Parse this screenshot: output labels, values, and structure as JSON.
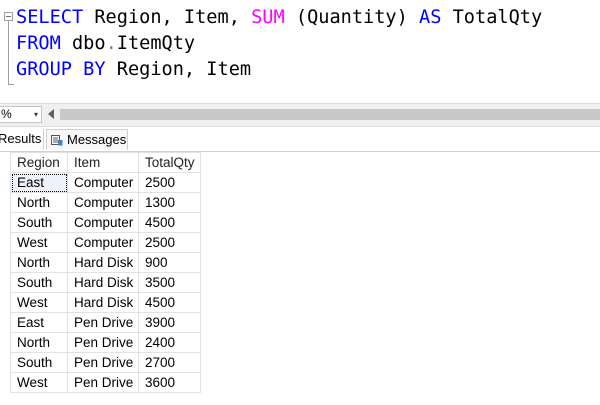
{
  "editor": {
    "line1": {
      "kw1": "SELECT",
      "t1": " Region, Item, ",
      "fn": "SUM",
      "t2": " (Quantity) ",
      "kw2": "AS",
      "t3": " TotalQty"
    },
    "line2": {
      "kw1": "FROM",
      "t1": " dbo",
      "op": ".",
      "t2": "ItemQty"
    },
    "line3": {
      "kw1": "GROUP BY",
      "t1": " Region, Item"
    }
  },
  "zoom": {
    "value": "%",
    "arrow": "▾"
  },
  "tabs": {
    "results": "Results",
    "messages": "Messages"
  },
  "grid": {
    "headers": [
      "Region",
      "Item",
      "TotalQty"
    ],
    "rows": [
      [
        "East",
        "Computer",
        "2500"
      ],
      [
        "North",
        "Computer",
        "1300"
      ],
      [
        "South",
        "Computer",
        "4500"
      ],
      [
        "West",
        "Computer",
        "2500"
      ],
      [
        "North",
        "Hard Disk",
        "900"
      ],
      [
        "South",
        "Hard Disk",
        "3500"
      ],
      [
        "West",
        "Hard Disk",
        "4500"
      ],
      [
        "East",
        "Pen Drive",
        "3900"
      ],
      [
        "North",
        "Pen Drive",
        "2400"
      ],
      [
        "South",
        "Pen Drive",
        "2700"
      ],
      [
        "West",
        "Pen Drive",
        "3600"
      ]
    ]
  },
  "colors": {
    "keyword": "#0000ff",
    "function": "#ff00ff",
    "operator": "#808080"
  }
}
